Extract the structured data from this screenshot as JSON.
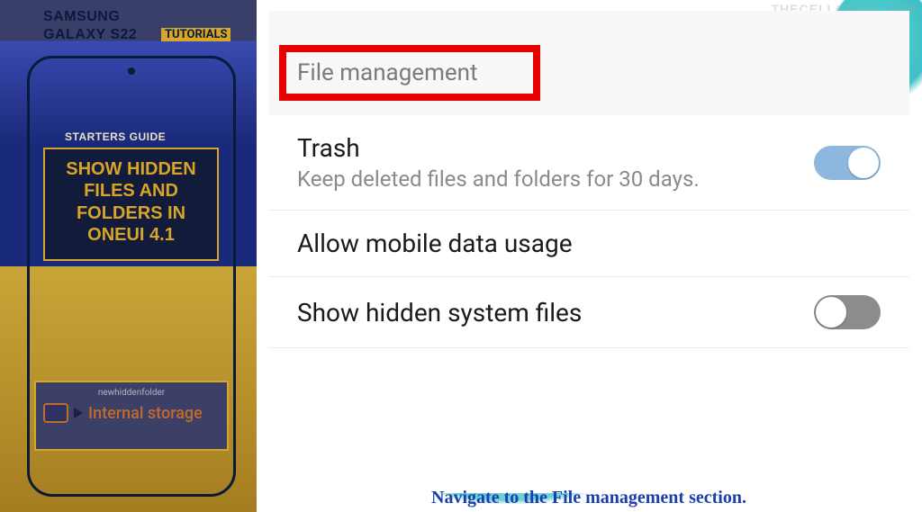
{
  "watermark": "THECELLGUIDE.COM",
  "sidebar": {
    "brand_line1": "SAMSUNG",
    "brand_line2": "GALAXY S22",
    "tutorials_tag": "TUTORIALS",
    "starters": "STARTERS GUIDE",
    "title_l1": "SHOW HIDDEN",
    "title_l2": "FILES AND",
    "title_l3": "FOLDERS IN",
    "title_l4": "ONEUI 4.1",
    "storage": {
      "hint": "newhiddenfolder",
      "label": "Internal storage"
    }
  },
  "panel": {
    "section_header": "File management",
    "settings": [
      {
        "title": "Trash",
        "sub": "Keep deleted files and folders for 30 days.",
        "toggle": "on"
      },
      {
        "title": "Allow mobile data usage",
        "sub": "",
        "toggle": ""
      },
      {
        "title": "Show hidden system files",
        "sub": "",
        "toggle": "off"
      }
    ]
  },
  "caption": "Navigate to the File management section."
}
